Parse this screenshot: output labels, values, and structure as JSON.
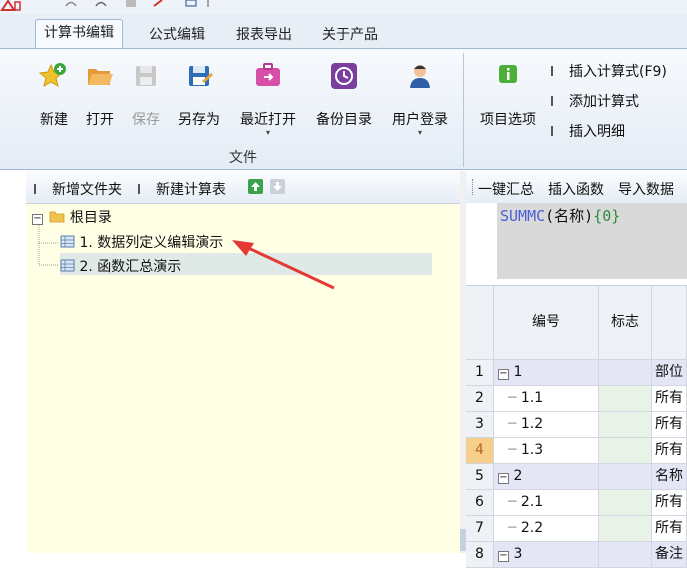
{
  "ribbon": {
    "tabs": [
      {
        "label": "计算书编辑",
        "active": true
      },
      {
        "label": "公式编辑"
      },
      {
        "label": "报表导出"
      },
      {
        "label": "关于产品"
      }
    ],
    "file_group": {
      "label": "文件",
      "buttons": [
        {
          "label": "新建",
          "icon": "new-star-icon"
        },
        {
          "label": "打开",
          "icon": "folder-open-icon"
        },
        {
          "label": "保存",
          "icon": "save-disk-icon",
          "disabled": true
        },
        {
          "label": "另存为",
          "icon": "save-as-icon"
        },
        {
          "label": "最近打开",
          "icon": "recent-briefcase-icon",
          "dropdown": true
        },
        {
          "label": "备份目录",
          "icon": "backup-clock-icon"
        },
        {
          "label": "用户登录",
          "icon": "user-icon",
          "dropdown": true
        }
      ]
    },
    "project_group": {
      "options_label": "项目选项",
      "insert_formula": "插入计算式(F9)",
      "add_formula": "添加计算式",
      "insert_detail": "插入明细"
    }
  },
  "left": {
    "toolbar": {
      "new_folder": "新增文件夹",
      "new_calc": "新建计算表"
    },
    "tree": {
      "root": "根目录",
      "items": [
        "1. 数据列定义编辑演示",
        "2. 函数汇总演示"
      ]
    }
  },
  "right": {
    "toolbar": {
      "summary": "一键汇总",
      "insert_func": "插入函数",
      "import_data": "导入数据"
    },
    "formula": {
      "func": "SUMMC",
      "args": "(名称)",
      "brace": "{0}"
    },
    "grid": {
      "headers": [
        "编号",
        "标志"
      ],
      "rows": [
        {
          "n": "1",
          "code": "1",
          "expand": true,
          "flag": "",
          "text": "部位"
        },
        {
          "n": "2",
          "code": "1.1",
          "flag": "",
          "text": "所有"
        },
        {
          "n": "3",
          "code": "1.2",
          "flag": "",
          "text": "所有"
        },
        {
          "n": "4",
          "code": "1.3",
          "flag": "",
          "text": "所有",
          "current": true
        },
        {
          "n": "5",
          "code": "2",
          "expand": true,
          "flag": "",
          "text": "名称"
        },
        {
          "n": "6",
          "code": "2.1",
          "flag": "",
          "text": "所有"
        },
        {
          "n": "7",
          "code": "2.2",
          "flag": "",
          "text": "所有"
        },
        {
          "n": "8",
          "code": "3",
          "expand": true,
          "flag": "",
          "text": "备注"
        }
      ]
    }
  },
  "colors": {
    "formula_func": "#4a5fd6",
    "formula_brace": "#2e8b3a",
    "annotation_arrow": "#e53935"
  }
}
